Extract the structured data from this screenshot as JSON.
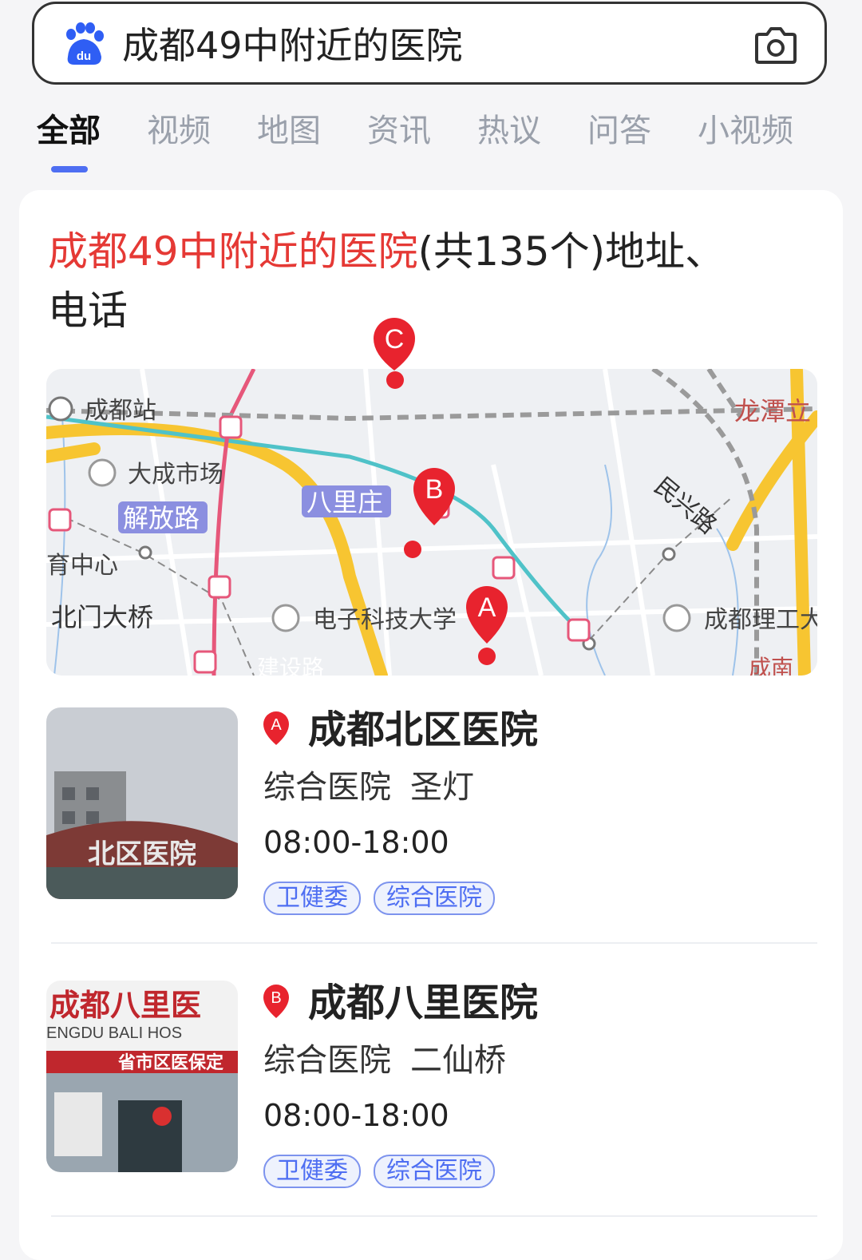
{
  "search": {
    "query": "成都49中附近的医院",
    "logo_icon": "baidu-paw-icon",
    "camera_icon": "camera-icon"
  },
  "tabs": [
    {
      "label": "全部",
      "active": true
    },
    {
      "label": "视频",
      "active": false
    },
    {
      "label": "地图",
      "active": false
    },
    {
      "label": "资讯",
      "active": false
    },
    {
      "label": "热议",
      "active": false
    },
    {
      "label": "问答",
      "active": false
    },
    {
      "label": "小视频",
      "active": false
    }
  ],
  "result": {
    "title_highlight": "成都49中附近的医院",
    "title_rest_1": "(共135个)地址、",
    "title_rest_2": "电话"
  },
  "map": {
    "labels": {
      "chengdu_station": "成都站",
      "longtan": "龙潭立",
      "dacheng_market": "大成市场",
      "jiefang_road": "解放路",
      "bali_zhuang": "八里庄",
      "minxing_road": "民兴路",
      "yu_center": "育中心",
      "beimen_bridge": "北门大桥",
      "uestc": "电子科技大学",
      "cdut": "成都理工大",
      "jianshe_road": "建设路",
      "chengnan": "成南"
    },
    "markers": [
      "A",
      "B",
      "C"
    ],
    "marker_color": "#e8232e"
  },
  "hospitals": [
    {
      "marker": "A",
      "name": "成都北区医院",
      "category": "综合医院",
      "area": "圣灯",
      "hours": "08:00-18:00",
      "tags": [
        "卫健委",
        "综合医院"
      ],
      "photo_sign": "北区医院"
    },
    {
      "marker": "B",
      "name": "成都八里医院",
      "category": "综合医院",
      "area": "二仙桥",
      "hours": "08:00-18:00",
      "tags": [
        "卫健委",
        "综合医院"
      ],
      "photo_sign_cn": "成都八里医",
      "photo_sign_en": "ENGDU BALI HOS",
      "photo_sign_2": "省市区医保定"
    }
  ],
  "colors": {
    "accent": "#4e6ef2",
    "highlight": "#e53935"
  }
}
